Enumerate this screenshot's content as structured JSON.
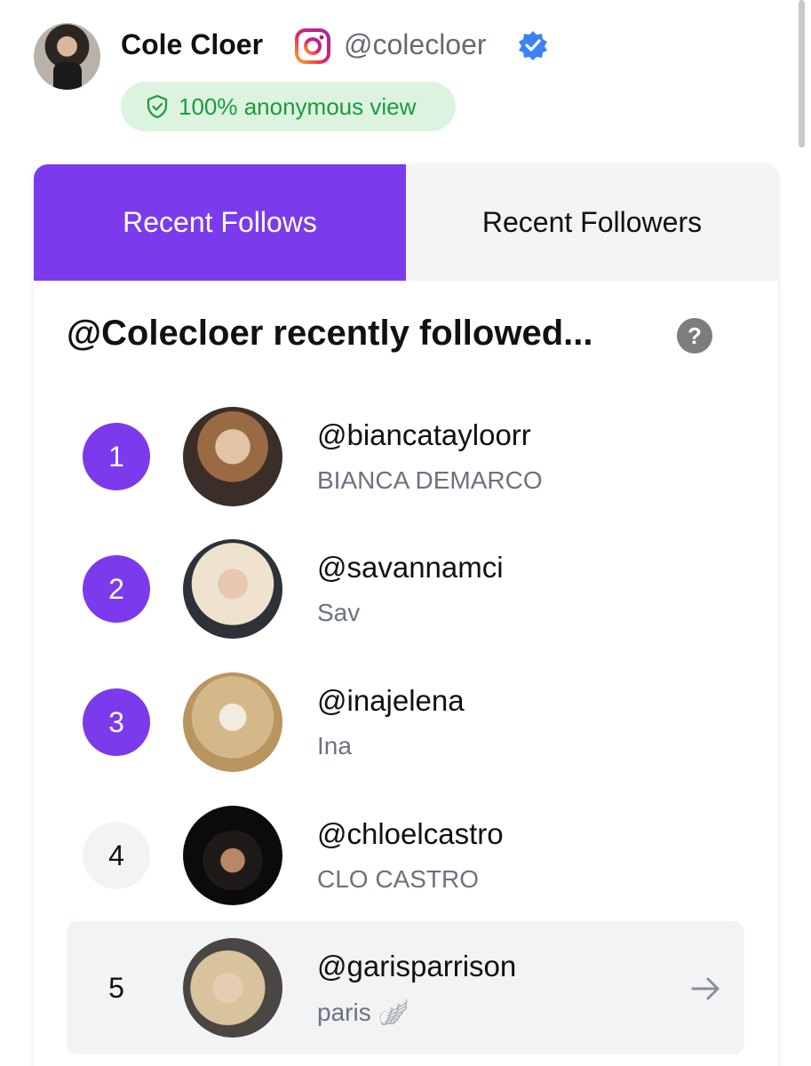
{
  "profile": {
    "name": "Cole Cloer",
    "handle": "@colecloer",
    "anonymous_label": "100% anonymous view"
  },
  "tabs": [
    {
      "label": "Recent Follows",
      "active": true
    },
    {
      "label": "Recent Followers",
      "active": false
    }
  ],
  "section_title": "@Colecloer recently followed...",
  "help_symbol": "?",
  "follows": [
    {
      "rank": "1",
      "username": "@biancatayloorr",
      "display_name": "BIANCA DEMARCO"
    },
    {
      "rank": "2",
      "username": "@savannamci",
      "display_name": "Sav"
    },
    {
      "rank": "3",
      "username": "@inajelena",
      "display_name": "Ina"
    },
    {
      "rank": "4",
      "username": "@chloelcastro",
      "display_name": "CLO CASTRO"
    },
    {
      "rank": "5",
      "username": "@garisparrison",
      "display_name": "paris 🪽"
    }
  ],
  "colors": {
    "accent": "#7c3aed",
    "badge_bg": "#dcf3e0",
    "badge_text": "#1c9a3e",
    "verified": "#3b82f6",
    "muted_text": "#6b7280"
  },
  "icons": [
    "instagram-icon",
    "verified-badge-icon",
    "shield-check-icon",
    "help-icon",
    "arrow-right-icon"
  ]
}
